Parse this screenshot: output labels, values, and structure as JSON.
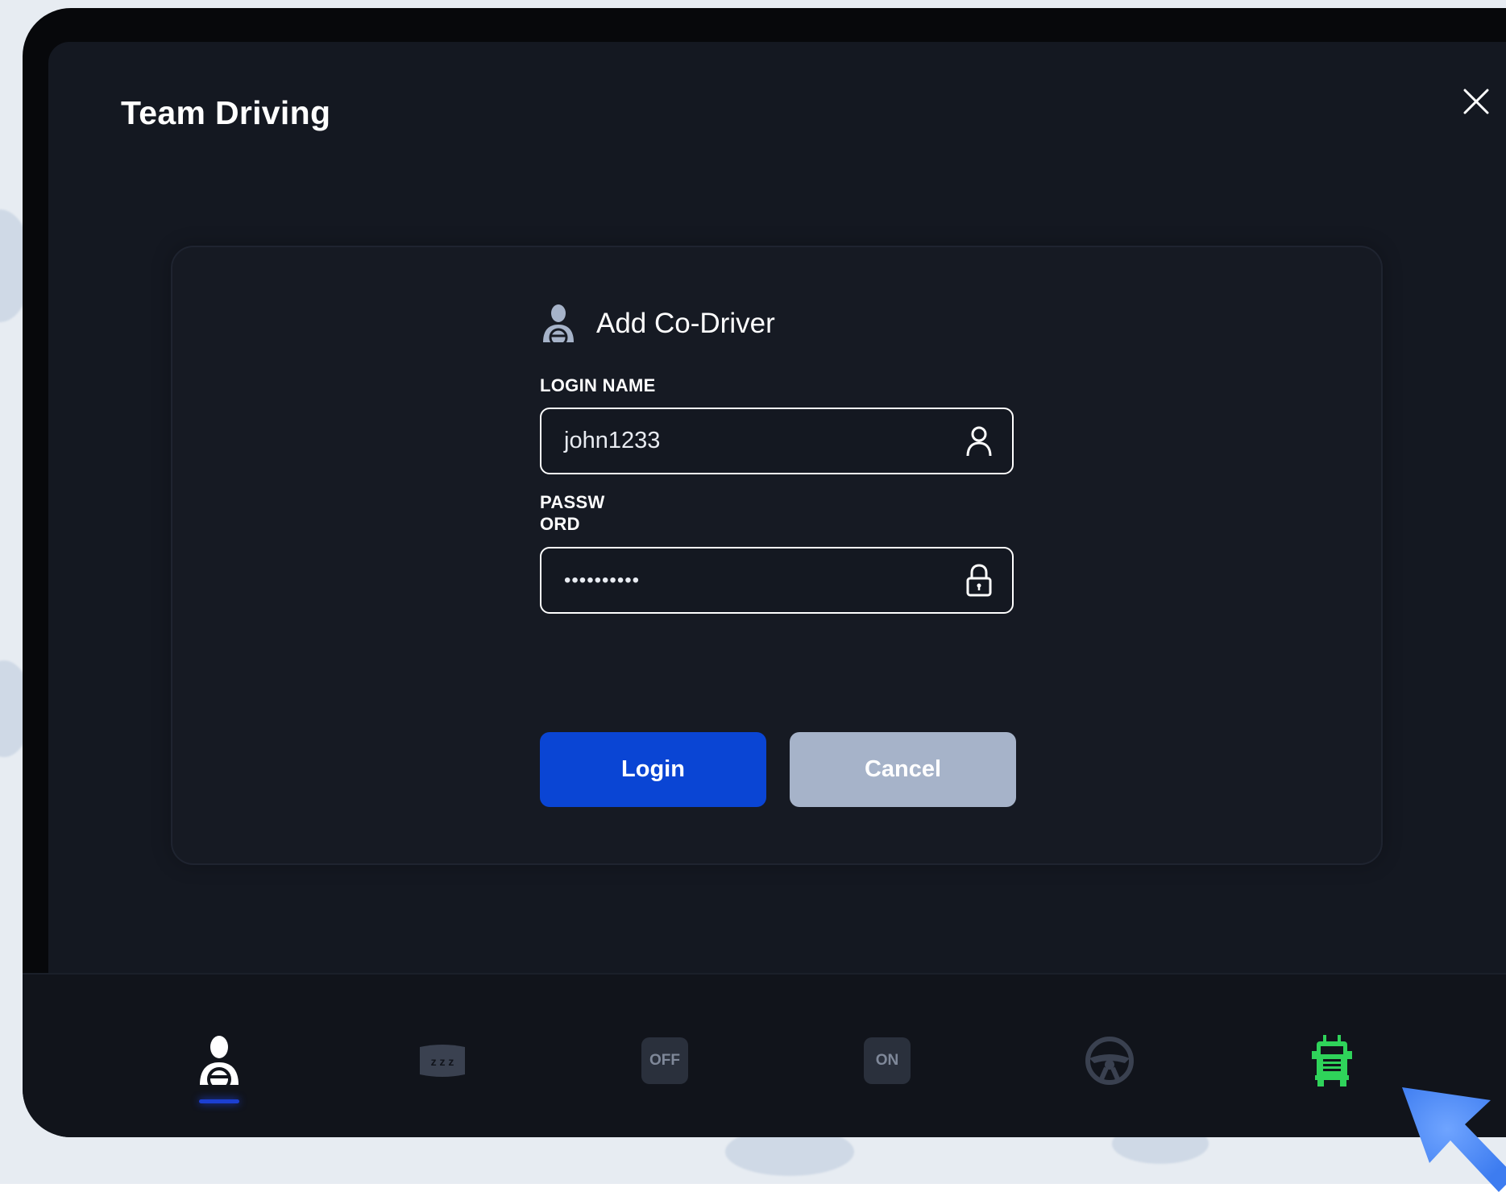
{
  "window": {
    "title": "Team Driving"
  },
  "dialog": {
    "title": "Add Co-Driver",
    "login_name": {
      "label": "LOGIN NAME",
      "value": "john1233"
    },
    "password": {
      "label_line1": "PASSW",
      "label_line2": "ORD",
      "masked_value": "••••••••••"
    },
    "login_button": "Login",
    "cancel_button": "Cancel"
  },
  "dock": {
    "items": [
      {
        "name": "driver",
        "icon": "driver-icon",
        "active": true
      },
      {
        "name": "sleeper",
        "icon": "sleeper-icon",
        "label": "z z z"
      },
      {
        "name": "off-duty",
        "icon": "off-duty-icon",
        "label": "OFF"
      },
      {
        "name": "on-duty",
        "icon": "on-duty-icon",
        "label": "ON"
      },
      {
        "name": "driving",
        "icon": "steering-wheel-icon"
      },
      {
        "name": "truck",
        "icon": "truck-icon"
      }
    ]
  },
  "colors": {
    "background": "#141821",
    "card": "#161a23",
    "primary": "#0a45d4",
    "cancel": "#a6b3c9",
    "truck_green": "#2fd35a",
    "accent_blue": "#1c3fd1",
    "icon_muted": "#3a4150"
  }
}
